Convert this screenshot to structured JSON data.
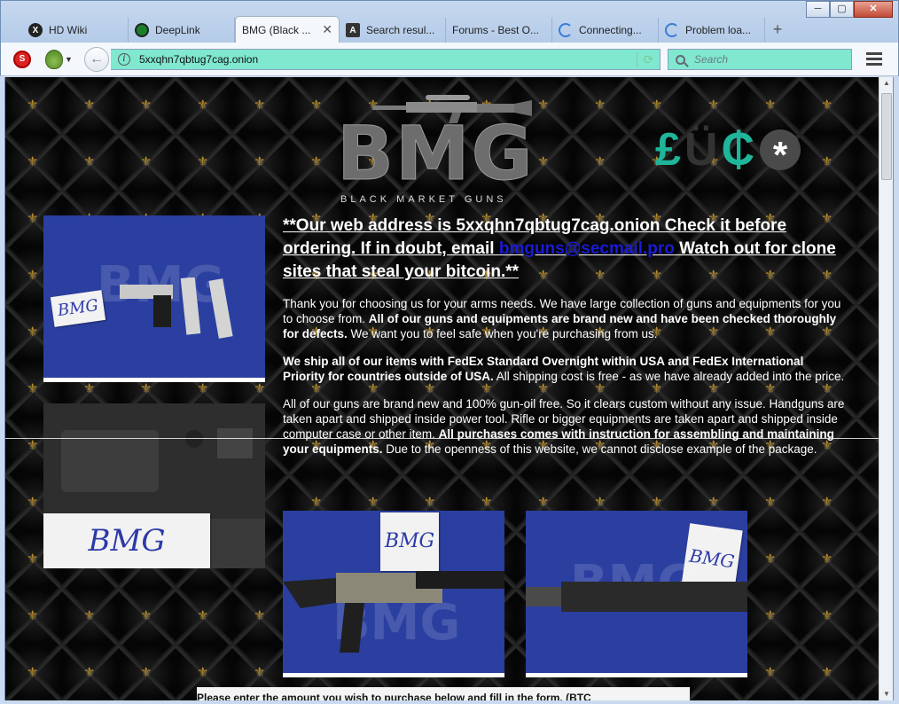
{
  "window": {
    "minimize_label": "─",
    "maximize_label": "▢",
    "close_label": "✕"
  },
  "tabs": [
    {
      "label": "HD Wiki",
      "icon": "hd-wiki-icon"
    },
    {
      "label": "DeepLink",
      "icon": "deeplink-icon"
    },
    {
      "label": "BMG (Black ...",
      "icon": "none",
      "active": true,
      "close": "✕"
    },
    {
      "label": "Search resul...",
      "icon": "search-engine-icon"
    },
    {
      "label": "Forums - Best O...",
      "icon": "none"
    },
    {
      "label": "Connecting...",
      "icon": "loading-spinner-icon"
    },
    {
      "label": "Problem loa...",
      "icon": "loading-spinner-icon"
    }
  ],
  "new_tab_label": "+",
  "toolbar": {
    "back_label": "←",
    "url": "5xxqhn7qbtug7cag.onion",
    "info_label": "i",
    "reload_label": "⟳",
    "search_placeholder": "Search"
  },
  "site": {
    "logo_letters": "BMG",
    "logo_sub": "BLACK   MARKET   GUNS",
    "crypto_symbols": [
      "£",
      "Ü",
      "₵",
      "*"
    ],
    "headline_pre": "**Our web address is 5xxqhn7qbtug7cag.onion Check it before ordering. If in doubt, email ",
    "headline_email": "bmguns@secmail.pro",
    "headline_post": " Watch out for clone sites that steal your bitcoin.**",
    "p1_a": "Thank you for choosing us for your arms needs. We have large collection of guns and equipments for you to choose from. ",
    "p1_b": "All of our guns and equipments are brand new and have been checked thoroughly for defects.",
    "p1_c": " We want you to feel safe when you're purchasing from us.",
    "p2_a": "We ship all of our items with FedEx Standard Overnight within USA and FedEx International Priority for countries outside of USA.",
    "p2_b": " All shipping cost is free - as we have already added into the price.",
    "p3_a": "All of our guns are brand new and 100% gun-oil free. So it clears custom without any issue. Handguns are taken apart and shipped inside power tool. Rifle or bigger equipments are taken apart and shipped inside computer case or other item. ",
    "p3_b": "All purchases comes with instruction for assembling and maintaining your equipments.",
    "p3_c": " Due to the openness of this website, we cannot disclose example of the package.",
    "photo_card_text": "BMG",
    "watermark": "BMG",
    "bottom_text": "Please enter the amount you wish to purchase below and fill in the form. (BTC"
  },
  "colors": {
    "url_bg": "#7fe8cf",
    "page_bg": "#070707",
    "fleur": "#b48a2a",
    "crypto_accent": "#1fb59a",
    "email_link": "#1a1ad8"
  }
}
